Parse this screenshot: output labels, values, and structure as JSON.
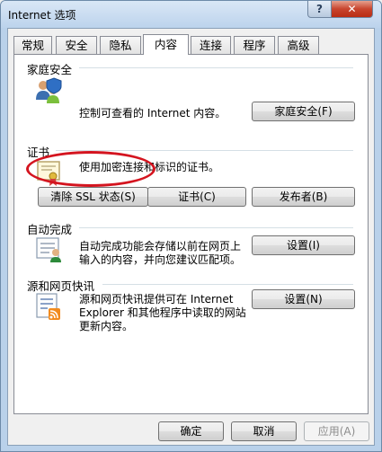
{
  "window": {
    "title": "Internet 选项",
    "help_label": "?",
    "close_label": "✕"
  },
  "tabs": [
    {
      "label": "常规"
    },
    {
      "label": "安全"
    },
    {
      "label": "隐私"
    },
    {
      "label": "内容"
    },
    {
      "label": "连接"
    },
    {
      "label": "程序"
    },
    {
      "label": "高级"
    }
  ],
  "active_tab": "内容",
  "family_safety": {
    "title": "家庭安全",
    "description": "控制可查看的 Internet 内容。",
    "button": "家庭安全(F)",
    "icon": "family-safety-icon"
  },
  "certificates": {
    "title": "证书",
    "description": "使用加密连接和标识的证书。",
    "clear_ssl_button": "清除 SSL 状态(S)",
    "certificates_button": "证书(C)",
    "publishers_button": "发布者(B)",
    "icon": "certificate-icon"
  },
  "autocomplete": {
    "title": "自动完成",
    "description_line1": "自动完成功能会存储以前在网页上",
    "description_line2": "输入的内容，并向您建议匹配项。",
    "button": "设置(I)",
    "icon": "autocomplete-icon"
  },
  "feeds": {
    "title": "源和网页快讯",
    "description_line1": "源和网页快讯提供可在 Internet",
    "description_line2": "Explorer 和其他程序中读取的网站",
    "description_line3": "更新内容。",
    "button": "设置(N)",
    "icon": "feeds-icon"
  },
  "footer": {
    "ok": "确定",
    "cancel": "取消",
    "apply": "应用(A)"
  },
  "colors": {
    "annotation_red": "#d4141f",
    "panel_bg": "#ffffff",
    "dialog_bg": "#f0f0f0"
  }
}
